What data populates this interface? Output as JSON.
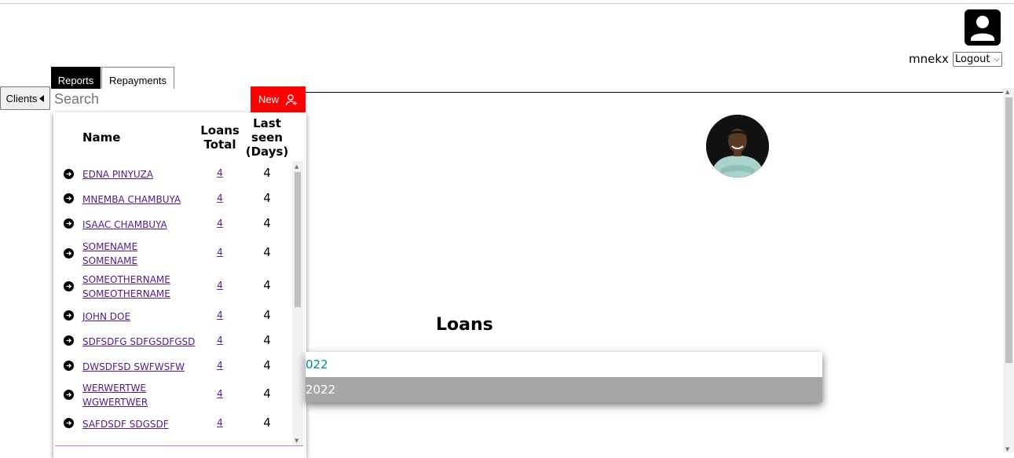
{
  "header": {
    "username": "mnekx",
    "logout_select": {
      "selected": "Logout"
    },
    "avatar_icon": "user-icon"
  },
  "tabs": [
    {
      "label": "Reports",
      "active": true
    },
    {
      "label": "Repayments",
      "active": false
    }
  ],
  "clients_toggle": {
    "label": "Clients",
    "icon": "caret-left-icon"
  },
  "search": {
    "placeholder": "Search",
    "value": ""
  },
  "new_button": {
    "label": "New",
    "icon": "add-user-icon"
  },
  "clients_table": {
    "columns": {
      "name": "Name",
      "loans_total": [
        "Loans",
        "Total"
      ],
      "last_seen": [
        "Last",
        "seen",
        "(Days)"
      ]
    },
    "rows": [
      {
        "name": "EDNA PINYUZA",
        "loans_total": "4",
        "last_seen": "4"
      },
      {
        "name": "MNEMBA CHAMBUYA",
        "loans_total": "4",
        "last_seen": "4"
      },
      {
        "name": "ISAAC CHAMBUYA",
        "loans_total": "4",
        "last_seen": "4"
      },
      {
        "name": "SOMENAME SOMENAME",
        "loans_total": "4",
        "last_seen": "4"
      },
      {
        "name": "SOMEOTHERNAME SOMEOTHERNAME",
        "loans_total": "4",
        "last_seen": "4"
      },
      {
        "name": "JOHN DOE",
        "loans_total": "4",
        "last_seen": "4"
      },
      {
        "name": "SDFSDFG SDFGSDFGSD",
        "loans_total": "4",
        "last_seen": "4"
      },
      {
        "name": "DWSDFSD SWFWSFW",
        "loans_total": "4",
        "last_seen": "4"
      },
      {
        "name": "WERWERTWE WGWERTWER",
        "loans_total": "4",
        "last_seen": "4"
      },
      {
        "name": "SAFDSDF SDGSDF",
        "loans_total": "4",
        "last_seen": "4"
      }
    ]
  },
  "loans": {
    "title": "Loans",
    "items": [
      "022",
      "2022"
    ]
  },
  "colors": {
    "new_button": "#ff0000",
    "active_tab": "#000000",
    "link": "#551a8b",
    "loan_item_text": "#008b8b",
    "loan_item_selected_bg": "#a6a6a6"
  }
}
